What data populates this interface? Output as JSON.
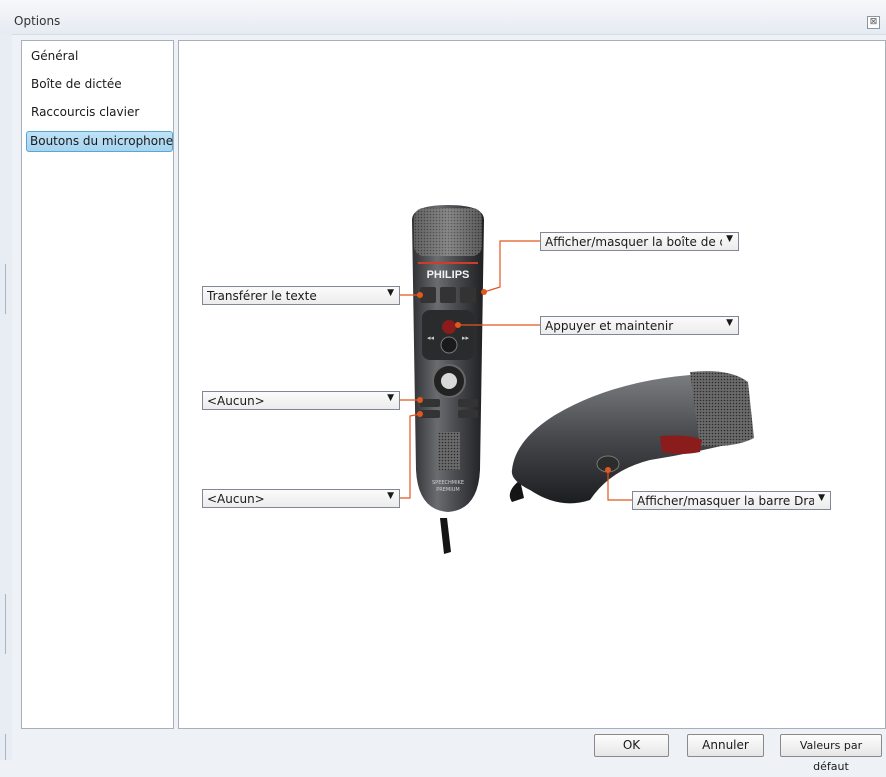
{
  "window": {
    "title": "Options",
    "close_glyph": "⊠"
  },
  "sidebar": {
    "items": [
      {
        "label": "Général",
        "selected": false
      },
      {
        "label": "Boîte de dictée",
        "selected": false
      },
      {
        "label": "Raccourcis clavier",
        "selected": false
      },
      {
        "label": "Boutons du microphone",
        "selected": true
      }
    ]
  },
  "mic": {
    "brand": "PHILIPS",
    "model_line1": "SPEECHMIKE",
    "model_line2": "PREMIUM"
  },
  "mappings": {
    "top_right": "Afficher/masquer la boîte de dicte",
    "left_record": "Transférer le texte",
    "right_middle": "Appuyer et maintenir",
    "left_f1": "<Aucun>",
    "left_f2": "<Aucun>",
    "side": "Afficher/masquer la barre Dragon"
  },
  "footer": {
    "ok": "OK",
    "cancel": "Annuler",
    "defaults": "Valeurs par défaut"
  },
  "colors": {
    "accent": "#e2571f",
    "selection": "#a7d4ef"
  }
}
